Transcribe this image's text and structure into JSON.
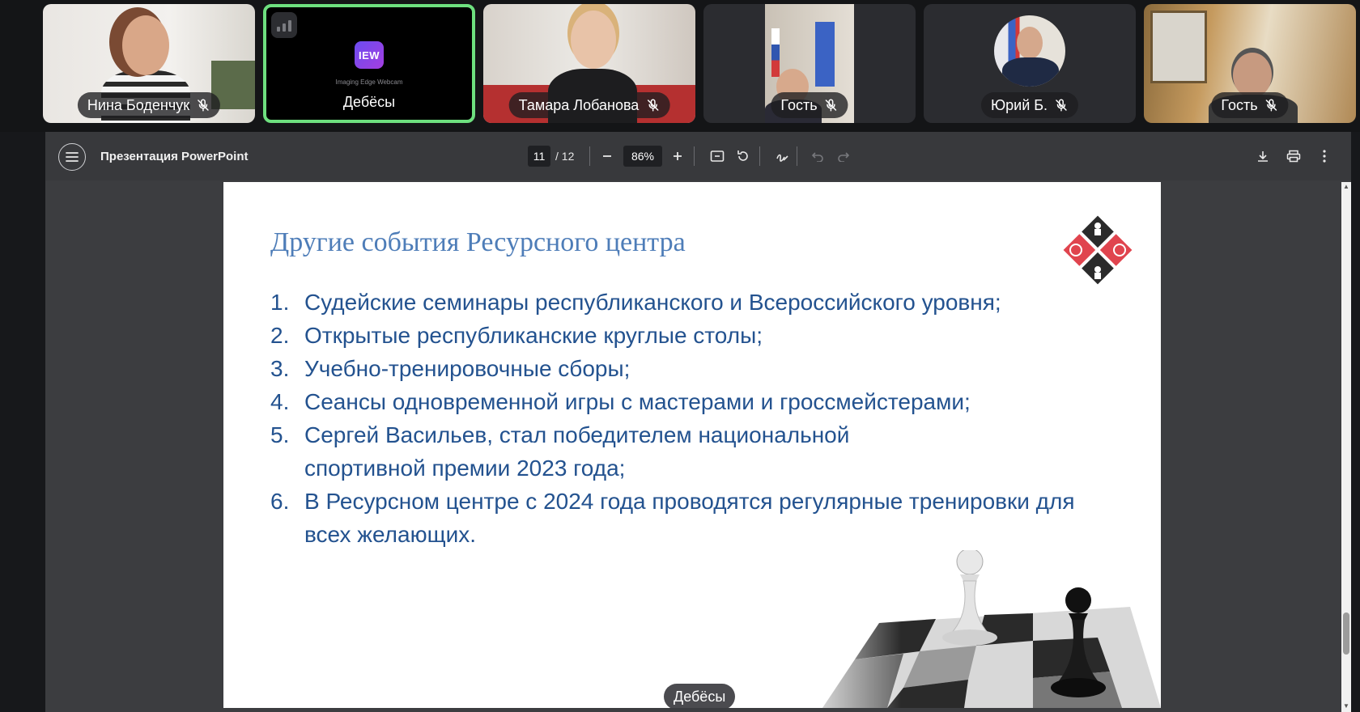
{
  "participants": [
    {
      "name": "Нина Боденчук",
      "muted": true
    },
    {
      "name": "Дебёсы",
      "muted": false,
      "active": true,
      "device_logo": "IEW",
      "device_caption": "Imaging Edge Webcam"
    },
    {
      "name": "Тамара Лобанова",
      "muted": true
    },
    {
      "name": "Гость",
      "muted": true
    },
    {
      "name": "Юрий Б.",
      "muted": true
    },
    {
      "name": "Гость",
      "muted": true
    }
  ],
  "viewer": {
    "title": "Презентация PowerPoint",
    "current_page": "11",
    "total_pages": "/ 12",
    "zoom": "86%",
    "icons": {
      "menu": "menu-icon",
      "zoom_out": "minus-icon",
      "zoom_in": "plus-icon",
      "fit": "fit-page-icon",
      "rotate": "rotate-icon",
      "annotate": "draw-icon",
      "undo": "undo-icon",
      "redo": "redo-icon",
      "download": "download-icon",
      "print": "print-icon",
      "more": "more-vert-icon"
    }
  },
  "slide": {
    "title": "Другие события Ресурсного центра",
    "items": [
      {
        "num": "1.",
        "text": "Судейские семинары республиканского и Всероссийского уровня;"
      },
      {
        "num": "2.",
        "text": "Открытые республиканские круглые столы;"
      },
      {
        "num": "3.",
        "text": "Учебно-тренировочные сборы;"
      },
      {
        "num": "4.",
        "text": "Сеансы одновременной игры с мастерами и гроссмейстерами;"
      },
      {
        "num": "5.",
        "text": "Сергей Васильев, стал победителем национальной спортивной премии 2023 года;"
      },
      {
        "num": "6.",
        "text": "В Ресурсном центре с 2024 года проводятся регулярные тренировки для всех желающих."
      }
    ],
    "colors": {
      "title": "#4e7db8",
      "text": "#23528f",
      "logo_red": "#e0444e",
      "logo_dark": "#2b2b2b"
    }
  },
  "speaker": {
    "name": "Дебёсы"
  },
  "colors": {
    "active_border": "#6ee07f",
    "background": "#17181b"
  }
}
